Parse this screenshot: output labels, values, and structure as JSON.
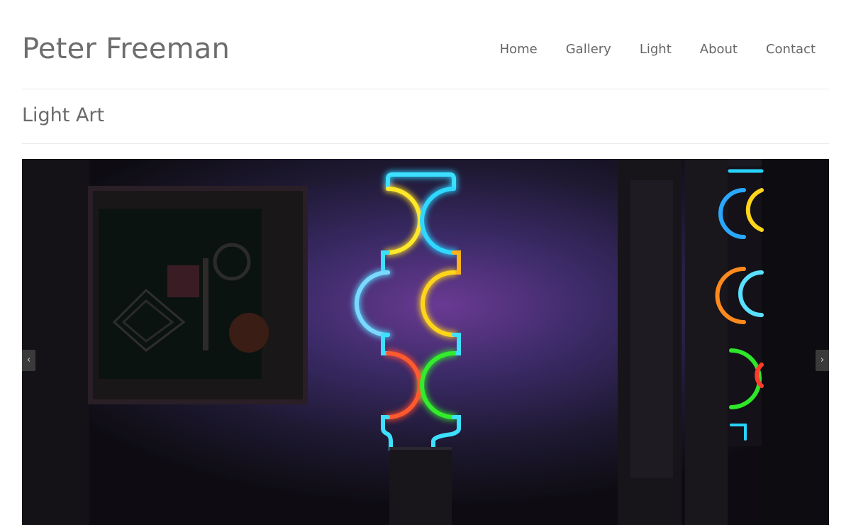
{
  "header": {
    "site_title": "Peter Freeman",
    "nav": [
      {
        "label": "Home"
      },
      {
        "label": "Gallery"
      },
      {
        "label": "Light"
      },
      {
        "label": "About"
      },
      {
        "label": "Contact"
      }
    ]
  },
  "main": {
    "page_title": "Light Art",
    "slider": {
      "prev_icon": "‹",
      "next_icon": "›"
    }
  },
  "colors": {
    "text": "#666666",
    "rule": "#e9e9e9",
    "slide_background": "#121015",
    "neon_cyan": "#27d3ff",
    "neon_yellow": "#ffe21a",
    "neon_orange": "#ff7a1c",
    "neon_red": "#ff3b2e",
    "neon_green": "#2ee62a",
    "neon_blue": "#3aa8ff"
  }
}
